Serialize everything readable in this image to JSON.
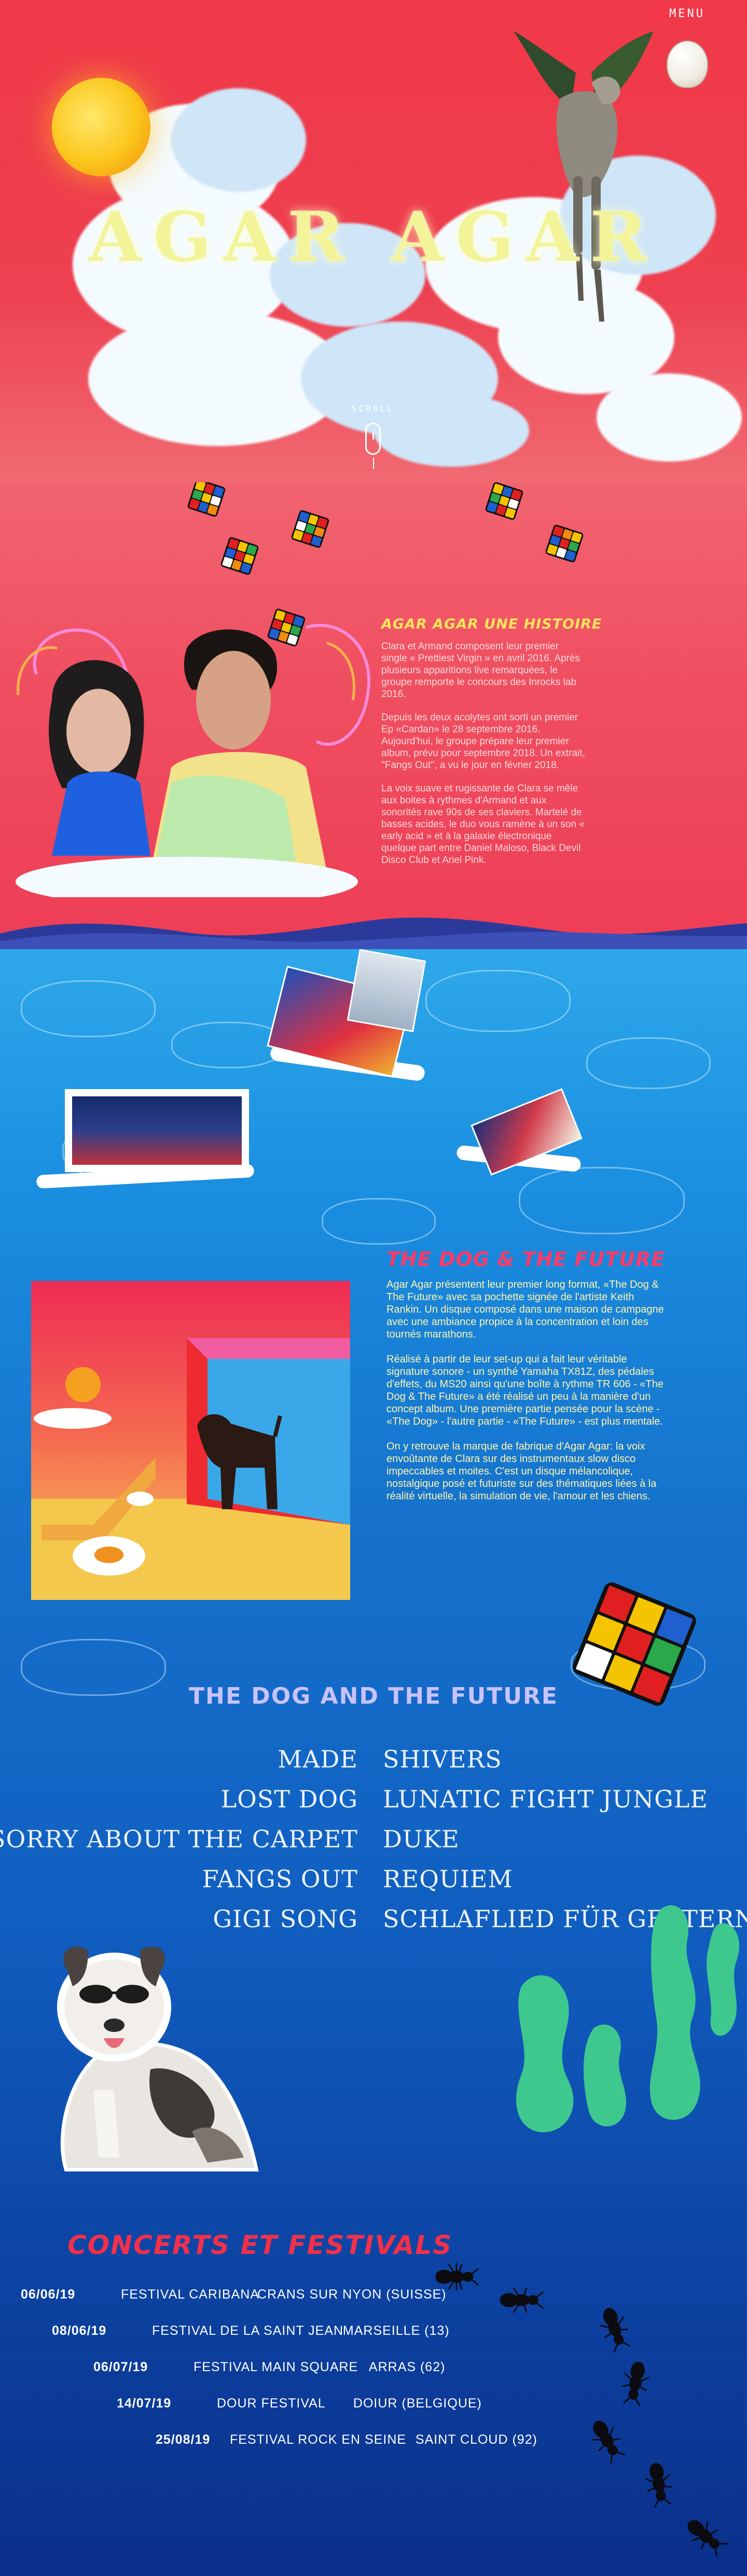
{
  "header": {
    "menu_label": "MENU",
    "title": "AGAR AGAR",
    "scroll_label": "SCROLL"
  },
  "history": {
    "title": "AGAR AGAR UNE HISTOIRE",
    "paragraphs": [
      "Clara et Armand composent leur premier single « Prettiest Virgin » en avril 2016. Après plusieurs apparitions live remarquées, le groupe remporte le concours des Inrocks lab 2016.",
      "Depuis les deux acolytes ont sorti un premier Ep «Cardan» le 28 septembre 2016. Aujourd'hui, le groupe prépare leur premier album, prévu pour septembre 2018. Un extrait, \"Fangs Out\", a vu le jour en février 2018.",
      "La voix suave et rugissante de Clara se mêle aux boites à rythmes d'Armand et aux sonorités rave 90s de ses claviers. Martelé de basses acides, le duo vous ramène à un son « early acid » et à la galaxie électronique quelque part entre Daniel Maloso, Black Devil Disco Club et Ariel Pink."
    ]
  },
  "album": {
    "title": "THE DOG & THE FUTURE",
    "paragraphs": [
      "Agar Agar présentent leur premier long format, «The Dog & The Future» avec sa pochette signée de l'artiste Keith Rankin. Un disque composé dans une maison de campagne avec une ambiance propice à la concentration et loin des tournés marathons.",
      "Réalisé à partir de leur set-up qui a fait leur véritable signature sonore - un synthé Yamaha TX81Z, des pédales d'effets, du MS20 ainsi qu'une boîte à rythme TR 606 - «The Dog & The Future» a été réalisé un peu à la manière d'un concept album. Une première partie pensée pour la scène - «The Dog» - l'autre partie - «The Future» - est plus mentale.",
      "On y retrouve la marque de fabrique d'Agar Agar: la voix envoûtante de Clara sur des instrumentaux slow disco impeccables et moites. C'est un disque mélancolique, nostalgique posé et futuriste sur des thématiques liées à la réalité virtuelle, la simulation de vie, l'amour et les chiens."
    ]
  },
  "tracklist": {
    "title": "THE DOG AND THE FUTURE",
    "rows": [
      {
        "left": "MADE",
        "right": "SHIVERS"
      },
      {
        "left": "LOST DOG",
        "right": "LUNATIC FIGHT JUNGLE"
      },
      {
        "left": "SORRY ABOUT THE CARPET",
        "right": "DUKE"
      },
      {
        "left": "FANGS OUT",
        "right": "REQUIEM"
      },
      {
        "left": "GIGI SONG",
        "right": "SCHLAFLIED FÜR GESTERN"
      }
    ]
  },
  "concerts": {
    "title": "CONCERTS ET FESTIVALS",
    "gigs": [
      {
        "date": "06/06/19",
        "festival": "FESTIVAL CARIBANA",
        "location": "CRANS SUR NYON (SUISSE)"
      },
      {
        "date": "08/06/19",
        "festival": "FESTIVAL DE LA SAINT JEAN",
        "location": "MARSEILLE (13)"
      },
      {
        "date": "06/07/19",
        "festival": "FESTIVAL MAIN SQUARE",
        "location": "ARRAS (62)"
      },
      {
        "date": "14/07/19",
        "festival": "DOUR FESTIVAL",
        "location": "DOIUR (BELGIQUE)"
      },
      {
        "date": "25/08/19",
        "festival": "FESTIVAL ROCK EN SEINE",
        "location": "SAINT CLOUD (92)"
      }
    ]
  },
  "icons": [
    "egg-menu-icon",
    "scroll-mouse-icon",
    "rubiks-cube-icon",
    "ant-icon"
  ],
  "colors": {
    "hero_red": "#f03848",
    "title_yellow": "#f3f39a",
    "history_title": "#ffe45c",
    "album_title": "#ff3a68",
    "tracklist_title": "#c9c2ff",
    "concert_title": "#f2304a",
    "water_blue": "#1672cc"
  }
}
